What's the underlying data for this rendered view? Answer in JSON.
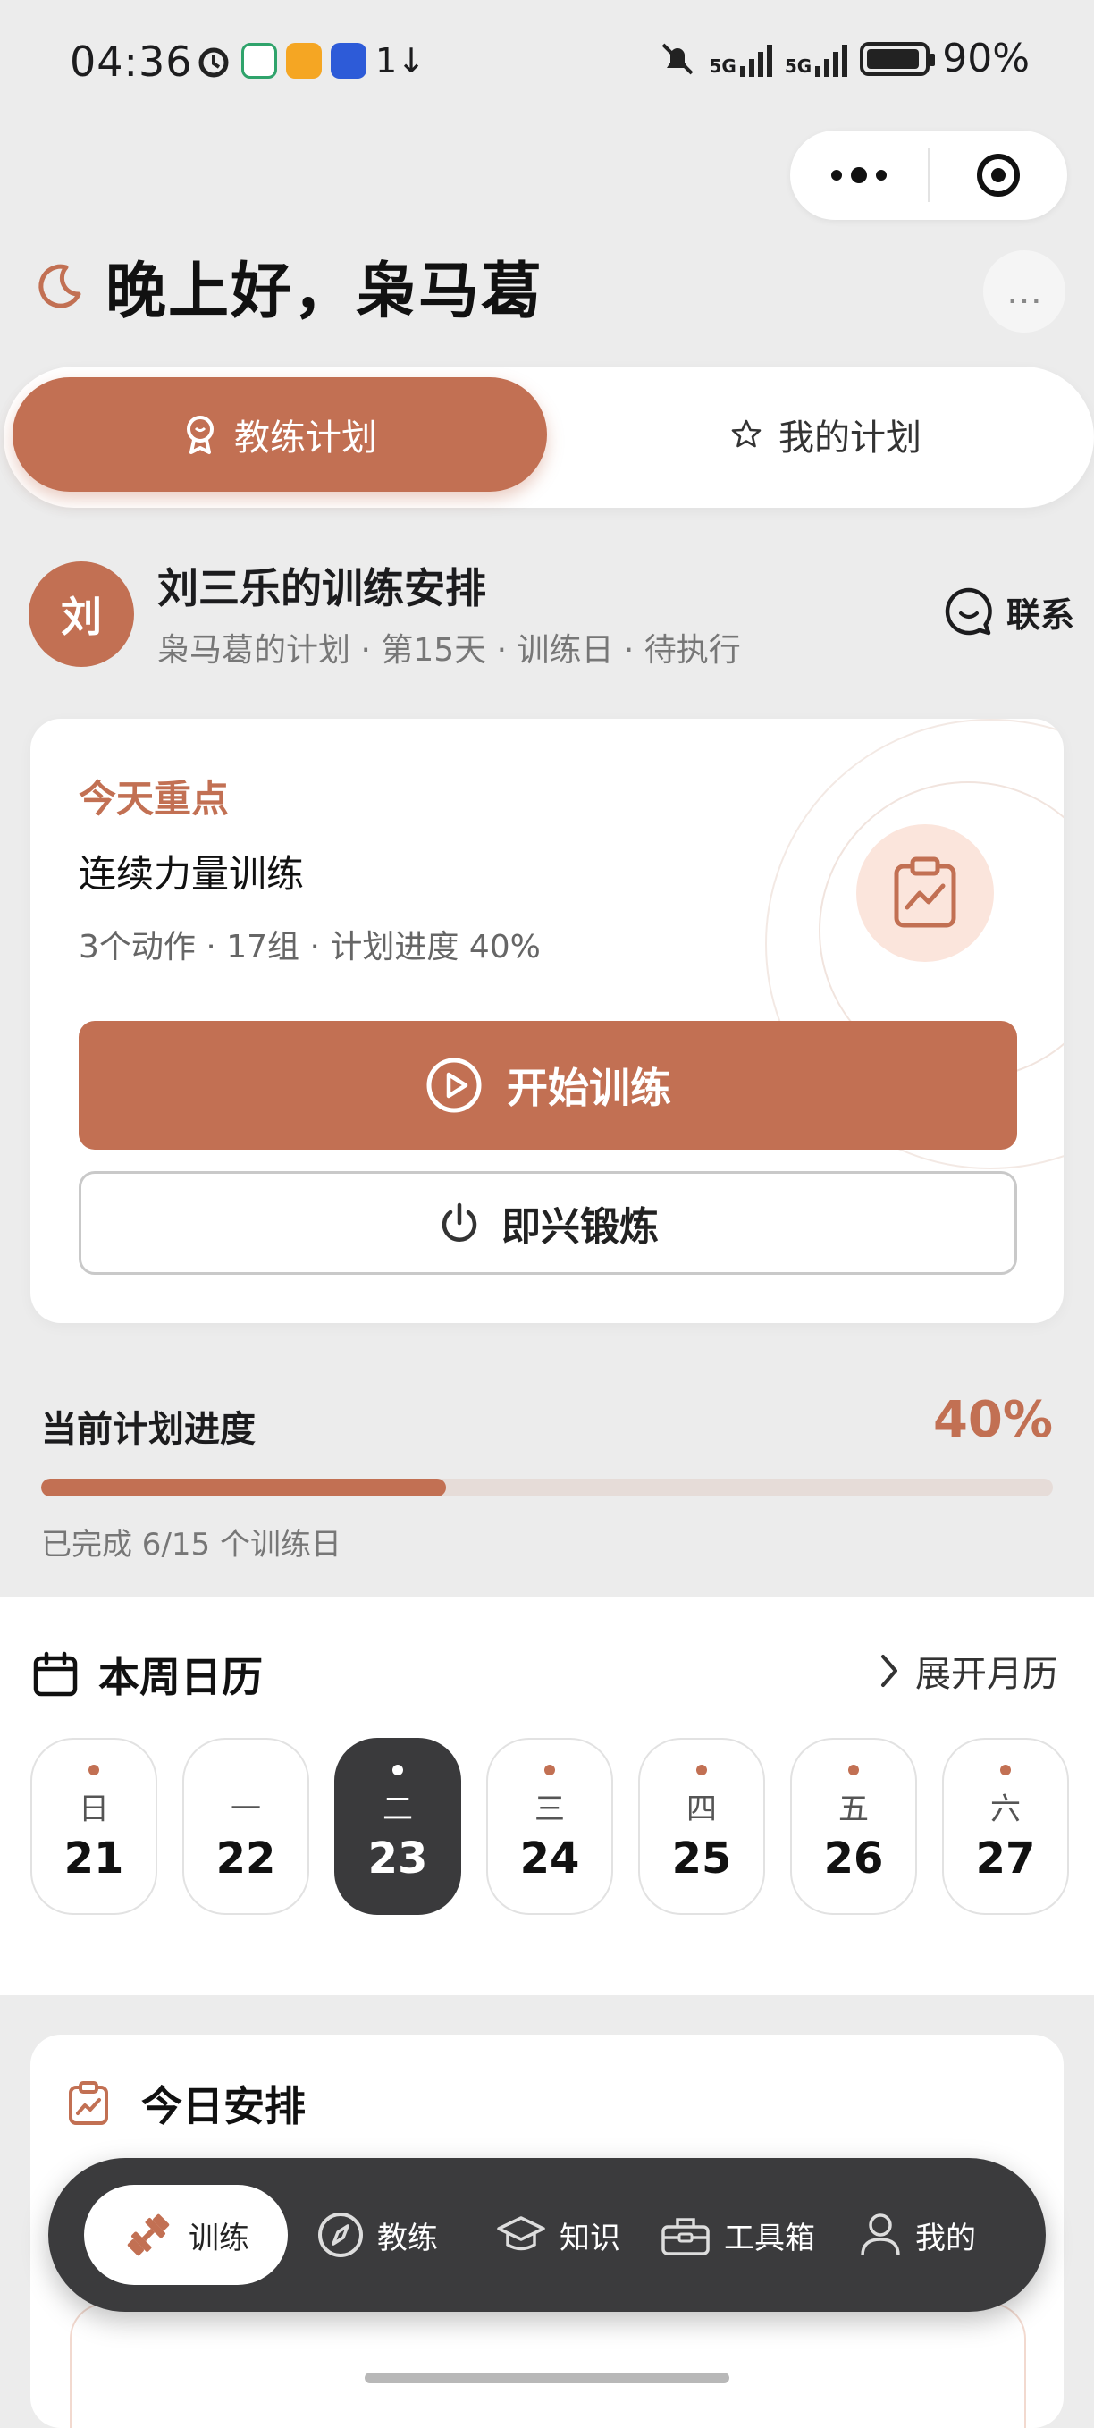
{
  "status_bar": {
    "time": "04:36",
    "network_left": "1↓",
    "signal_1": "5G",
    "signal_2": "5G",
    "battery": "90%"
  },
  "greeting": {
    "text": "晚上好，枭马葛"
  },
  "tabs": [
    {
      "label": "教练计划",
      "active": true
    },
    {
      "label": "我的计划",
      "active": false
    }
  ],
  "coach": {
    "avatar_text": "刘",
    "title": "刘三乐的训练安排",
    "subtitle": "枭马葛的计划 · 第15天 · 训练日 · 待执行",
    "contact_label": "联系"
  },
  "focus": {
    "label": "今天重点",
    "title": "连续力量训练",
    "meta": "3个动作 · 17组 · 计划进度 40%",
    "start_label": "开始训练",
    "impromptu_label": "即兴锻炼"
  },
  "progress": {
    "label": "当前计划进度",
    "percent_text": "40%",
    "value": 0.4,
    "sub": "已完成 6/15 个训练日"
  },
  "calendar": {
    "title": "本周日历",
    "expand_label": "展开月历",
    "days": [
      {
        "weekday": "日",
        "date": "21",
        "active": false
      },
      {
        "weekday": "一",
        "date": "22",
        "active": false
      },
      {
        "weekday": "二",
        "date": "23",
        "active": true
      },
      {
        "weekday": "三",
        "date": "24",
        "active": false
      },
      {
        "weekday": "四",
        "date": "25",
        "active": false
      },
      {
        "weekday": "五",
        "date": "26",
        "active": false
      },
      {
        "weekday": "六",
        "date": "27",
        "active": false
      }
    ]
  },
  "today": {
    "title": "今日安排"
  },
  "nav": {
    "items": [
      {
        "label": "训练",
        "icon": "dumbbell-icon",
        "active": true
      },
      {
        "label": "教练",
        "icon": "compass-icon",
        "active": false
      },
      {
        "label": "知识",
        "icon": "graduation-cap-icon",
        "active": false
      },
      {
        "label": "工具箱",
        "icon": "toolbox-icon",
        "active": false
      },
      {
        "label": "我的",
        "icon": "user-icon",
        "active": false
      }
    ]
  },
  "colors": {
    "accent": "#c27053",
    "dark": "#3a3a3c",
    "background": "#ececec"
  }
}
